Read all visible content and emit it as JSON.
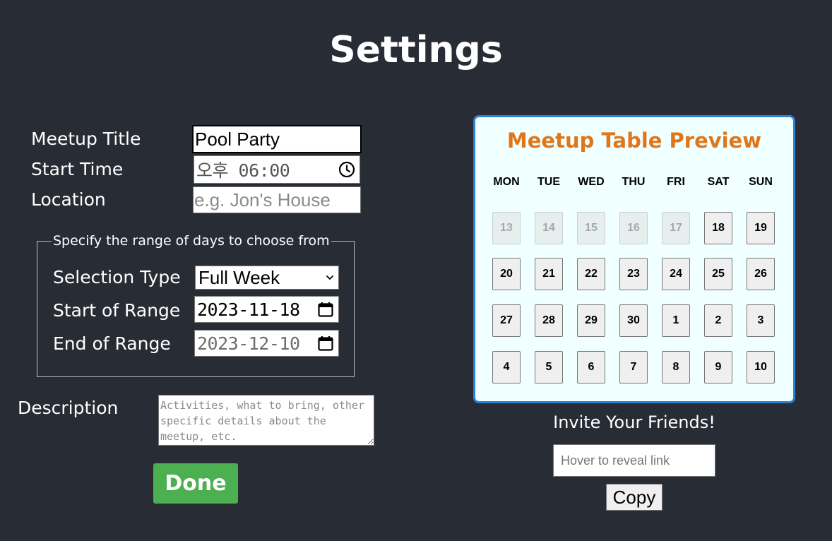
{
  "page": {
    "title": "Settings"
  },
  "form": {
    "meetup_title_label": "Meetup Title",
    "meetup_title_value": "Pool Party",
    "start_time_label": "Start Time",
    "start_time_value": "오후 06:00",
    "location_label": "Location",
    "location_placeholder": "e.g. Jon's House",
    "range": {
      "legend": "Specify the range of days to choose from",
      "selection_type_label": "Selection Type",
      "selection_type_value": "Full Week",
      "start_label": "Start of Range",
      "start_value": "2023-11-18",
      "end_label": "End of Range",
      "end_value": "2023-12-10"
    },
    "description_label": "Description",
    "description_placeholder": "Activities, what to bring, other specific details about the meetup, etc.",
    "done_label": "Done"
  },
  "preview": {
    "title": "Meetup Table Preview",
    "day_headers": [
      "MON",
      "TUE",
      "WED",
      "THU",
      "FRI",
      "SAT",
      "SUN"
    ],
    "weeks": [
      [
        {
          "day": "13",
          "enabled": false
        },
        {
          "day": "14",
          "enabled": false
        },
        {
          "day": "15",
          "enabled": false
        },
        {
          "day": "16",
          "enabled": false
        },
        {
          "day": "17",
          "enabled": false
        },
        {
          "day": "18",
          "enabled": true
        },
        {
          "day": "19",
          "enabled": true
        }
      ],
      [
        {
          "day": "20",
          "enabled": true
        },
        {
          "day": "21",
          "enabled": true
        },
        {
          "day": "22",
          "enabled": true
        },
        {
          "day": "23",
          "enabled": true
        },
        {
          "day": "24",
          "enabled": true
        },
        {
          "day": "25",
          "enabled": true
        },
        {
          "day": "26",
          "enabled": true
        }
      ],
      [
        {
          "day": "27",
          "enabled": true
        },
        {
          "day": "28",
          "enabled": true
        },
        {
          "day": "29",
          "enabled": true
        },
        {
          "day": "30",
          "enabled": true
        },
        {
          "day": "1",
          "enabled": true
        },
        {
          "day": "2",
          "enabled": true
        },
        {
          "day": "3",
          "enabled": true
        }
      ],
      [
        {
          "day": "4",
          "enabled": true
        },
        {
          "day": "5",
          "enabled": true
        },
        {
          "day": "6",
          "enabled": true
        },
        {
          "day": "7",
          "enabled": true
        },
        {
          "day": "8",
          "enabled": true
        },
        {
          "day": "9",
          "enabled": true
        },
        {
          "day": "10",
          "enabled": true
        }
      ]
    ]
  },
  "invite": {
    "label": "Invite Your Friends!",
    "link_placeholder": "Hover to reveal link",
    "copy_label": "Copy"
  },
  "icons": {
    "time_picker": "clock-icon",
    "date_picker": "calendar-icon",
    "select": "chevron-down-icon"
  },
  "colors": {
    "background": "#282c34",
    "done_button": "#4caf50",
    "preview_title": "#e0761a",
    "preview_border": "#2f7fd9",
    "preview_background": "#f0ffff"
  }
}
